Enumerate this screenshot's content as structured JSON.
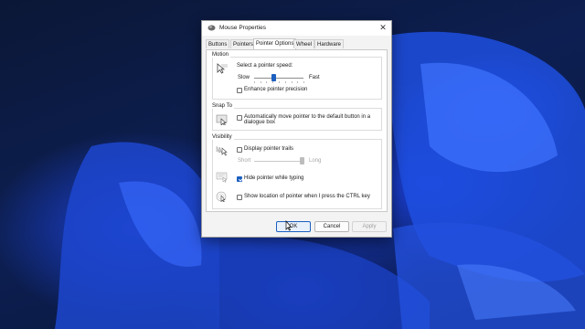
{
  "window": {
    "title": "Mouse Properties"
  },
  "tabs": [
    {
      "label": "Buttons"
    },
    {
      "label": "Pointers"
    },
    {
      "label": "Pointer Options",
      "active": true
    },
    {
      "label": "Wheel"
    },
    {
      "label": "Hardware"
    }
  ],
  "motion": {
    "group_label": "Motion",
    "speed_label": "Select a pointer speed:",
    "slow_label": "Slow",
    "fast_label": "Fast",
    "speed_value": 0.5,
    "precision_label": "Enhance pointer precision",
    "precision_checked": false
  },
  "snap": {
    "group_label": "Snap To",
    "label_line1": "Automatically move pointer to the default button in a",
    "label_line2": "dialogue box",
    "checked": false
  },
  "visibility": {
    "group_label": "Visibility",
    "trails_label": "Display pointer trails",
    "trails_checked": false,
    "short_label": "Short",
    "long_label": "Long",
    "trails_value": 1.0,
    "hide_label": "Hide pointer while typing",
    "hide_checked": true,
    "ctrl_label": "Show location of pointer when I press the CTRL key",
    "ctrl_checked": false
  },
  "buttons": {
    "ok": "OK",
    "cancel": "Cancel",
    "apply": "Apply"
  },
  "colors": {
    "accent": "#1c5fbf",
    "wallpaper": "#1a47d6"
  }
}
